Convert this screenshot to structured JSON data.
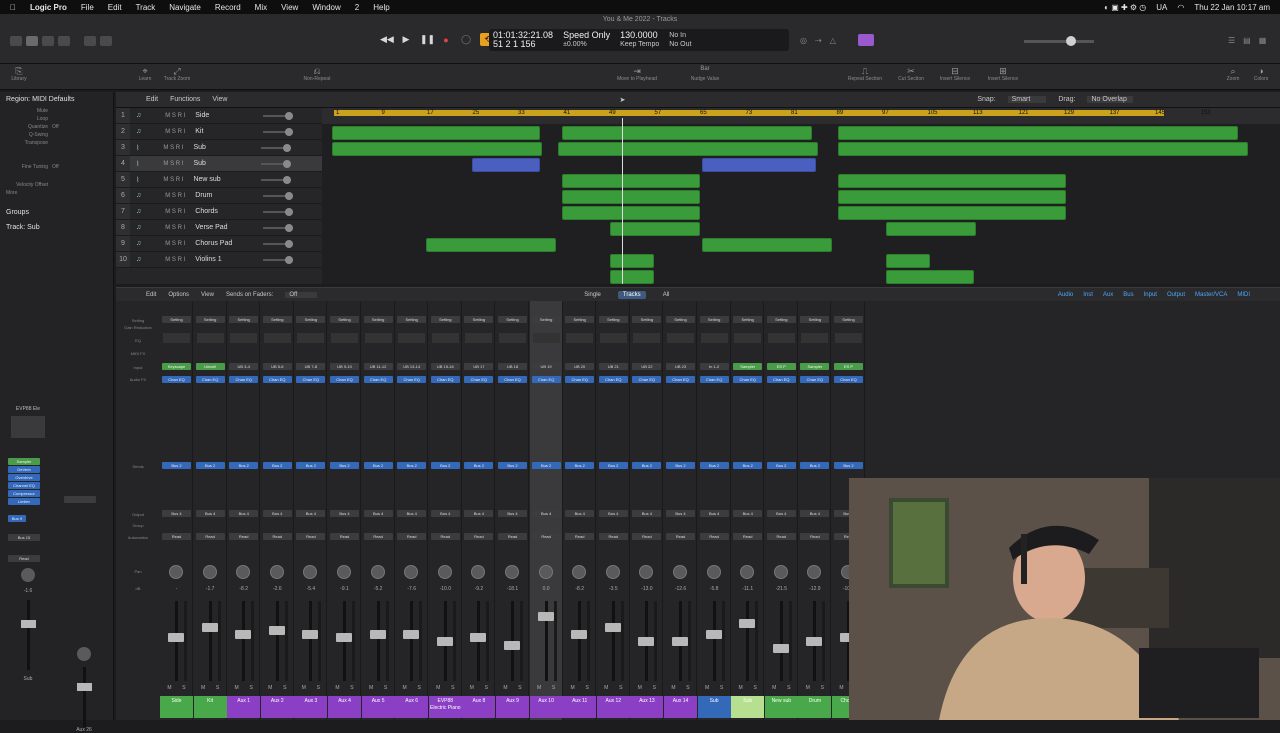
{
  "menubar": {
    "app": "Logic Pro",
    "items": [
      "File",
      "Edit",
      "Track",
      "Navigate",
      "Record",
      "Mix",
      "View",
      "Window",
      "2",
      "Help"
    ],
    "lang": "UA",
    "datetime": "Thu 22 Jan 10:17 am"
  },
  "window": {
    "title": "You & Me 2022 - Tracks"
  },
  "lcd": {
    "timecode": "01:01:32:21.08",
    "bars": "51  2  1  156",
    "mode": "Speed Only",
    "percent": "±0.00%",
    "tempo": "130.0000",
    "keep": "Keep Tempo",
    "in": "No In",
    "out": "No Out"
  },
  "toolbar": {
    "items": [
      "Library",
      "Inspector",
      "Learn",
      "Track Zoom",
      "Non-Repeat",
      "Move to Playhead",
      "Nudge Value",
      "Repeat Section",
      "Cut Section",
      "Insert Silence",
      "Insert Silence",
      "Zoom",
      "Colors"
    ],
    "nudge": "Bar"
  },
  "inspector": {
    "region": "Region: MIDI Defaults",
    "params": [
      {
        "k": "Mute",
        "v": ""
      },
      {
        "k": "Loop",
        "v": ""
      },
      {
        "k": "Quantize",
        "v": "Off"
      },
      {
        "k": "Q-Swing",
        "v": ""
      },
      {
        "k": "Transpose",
        "v": ""
      },
      {
        "k": "Fine Tuning",
        "v": "Off"
      },
      {
        "k": "Velocity Offset",
        "v": ""
      }
    ],
    "more": "More",
    "groups": "Groups",
    "track": "Track: Sub"
  },
  "tracks_menu": [
    "Edit",
    "Functions",
    "View"
  ],
  "snap": {
    "label": "Snap:",
    "value": "Smart",
    "drag_label": "Drag:",
    "drag_value": "No Overlap"
  },
  "ruler_marks": [
    "1",
    "9",
    "17",
    "25",
    "33",
    "41",
    "49",
    "57",
    "65",
    "73",
    "81",
    "89",
    "97",
    "105",
    "113",
    "121",
    "129",
    "137",
    "145",
    "153"
  ],
  "tracks": [
    {
      "num": "1",
      "name": "Side"
    },
    {
      "num": "2",
      "name": "Kit"
    },
    {
      "num": "3",
      "name": "Sub"
    },
    {
      "num": "4",
      "name": "Sub"
    },
    {
      "num": "5",
      "name": "New sub"
    },
    {
      "num": "6",
      "name": "Drum"
    },
    {
      "num": "7",
      "name": "Chords"
    },
    {
      "num": "8",
      "name": "Verse Pad"
    },
    {
      "num": "9",
      "name": "Chorus Pad"
    },
    {
      "num": "10",
      "name": "Violins 1"
    }
  ],
  "mixer_menu": [
    "Edit",
    "Options",
    "View",
    "Sends on Faders:",
    "Off"
  ],
  "mixer_tabs": [
    "Single",
    "Tracks",
    "All"
  ],
  "mixer_filters": [
    "Audio",
    "Inst",
    "Aux",
    "Bus",
    "Input",
    "Output",
    "Master/VCA",
    "MIDI"
  ],
  "mixer_row_labels": [
    "Setting",
    "Gain Reduction",
    "EQ",
    "MIDI FX",
    "Input",
    "Audio FX",
    "Sends",
    "Output",
    "Group",
    "Automation",
    "Pan",
    "dB"
  ],
  "inspector_strip": {
    "plugin": "EVP88 Ele",
    "chips": [
      "Sampler",
      "DeVerb",
      "Overdrive",
      "Channel EQ",
      "Compressor",
      "Limiter"
    ],
    "send": "Bus 9",
    "output": "Bus 15",
    "read": "Read",
    "db": "-1.6",
    "name": "Sub",
    "aux_name": "Aux 26"
  },
  "strips": [
    {
      "input": "Keyscape",
      "name": "Side",
      "color": "#49a84a",
      "db": "-",
      "fader": 0.55
    },
    {
      "input": "Unicell",
      "name": "Kit",
      "color": "#49a84a",
      "db": "-1.7",
      "fader": 0.7
    },
    {
      "input": "UB 3-4",
      "name": "Aux 1",
      "color": "#8a3fc4",
      "db": "-8.2",
      "fader": 0.6
    },
    {
      "input": "UB 5-6",
      "name": "Aux 2",
      "color": "#8a3fc4",
      "db": "-2.6",
      "fader": 0.65
    },
    {
      "input": "UB 7-8",
      "name": "Aux 3",
      "color": "#8a3fc4",
      "db": "-5.4",
      "fader": 0.6
    },
    {
      "input": "UB 9-10",
      "name": "Aux 4",
      "color": "#8a3fc4",
      "db": "-9.1",
      "fader": 0.55
    },
    {
      "input": "UB 11-12",
      "name": "Aux 5",
      "color": "#8a3fc4",
      "db": "-5.2",
      "fader": 0.6
    },
    {
      "input": "UB 13-14",
      "name": "Aux 6",
      "color": "#8a3fc4",
      "db": "-7.6",
      "fader": 0.6
    },
    {
      "input": "UB 15-16",
      "name": "EVP88 Electric Piano",
      "color": "#8a3fc4",
      "db": "-10.0",
      "fader": 0.5
    },
    {
      "input": "UB 17",
      "name": "Aux 8",
      "color": "#8a3fc4",
      "db": "-9.2",
      "fader": 0.55
    },
    {
      "input": "UB 18",
      "name": "Aux 9",
      "color": "#8a3fc4",
      "db": "-18.1",
      "fader": 0.45
    },
    {
      "input": "UB 19",
      "name": "Aux 10",
      "color": "#8a3fc4",
      "db": "0.0",
      "fader": 0.85
    },
    {
      "input": "UB 20",
      "name": "Aux 11",
      "color": "#8a3fc4",
      "db": "-8.2",
      "fader": 0.6
    },
    {
      "input": "UB 21",
      "name": "Aux 12",
      "color": "#8a3fc4",
      "db": "-3.5",
      "fader": 0.7
    },
    {
      "input": "UB 22",
      "name": "Aux 13",
      "color": "#8a3fc4",
      "db": "-13.0",
      "fader": 0.5
    },
    {
      "input": "UB 23",
      "name": "Aux 14",
      "color": "#8a3fc4",
      "db": "-12.6",
      "fader": 0.5
    },
    {
      "input": "In 1-2",
      "name": "Sub",
      "color": "#3468b8",
      "db": "-5.8",
      "fader": 0.6
    },
    {
      "input": "Sampler",
      "name": "Sub",
      "color": "#b6e08f",
      "db": "-11.1",
      "fader": 0.75
    },
    {
      "input": "ES P",
      "name": "New sub",
      "color": "#49a84a",
      "db": "-21.5",
      "fader": 0.4
    },
    {
      "input": "Sampler",
      "name": "Drum",
      "color": "#49a84a",
      "db": "-12.9",
      "fader": 0.5
    },
    {
      "input": "ES P",
      "name": "Chords",
      "color": "#49a84a",
      "db": "-10.2",
      "fader": 0.55
    }
  ]
}
